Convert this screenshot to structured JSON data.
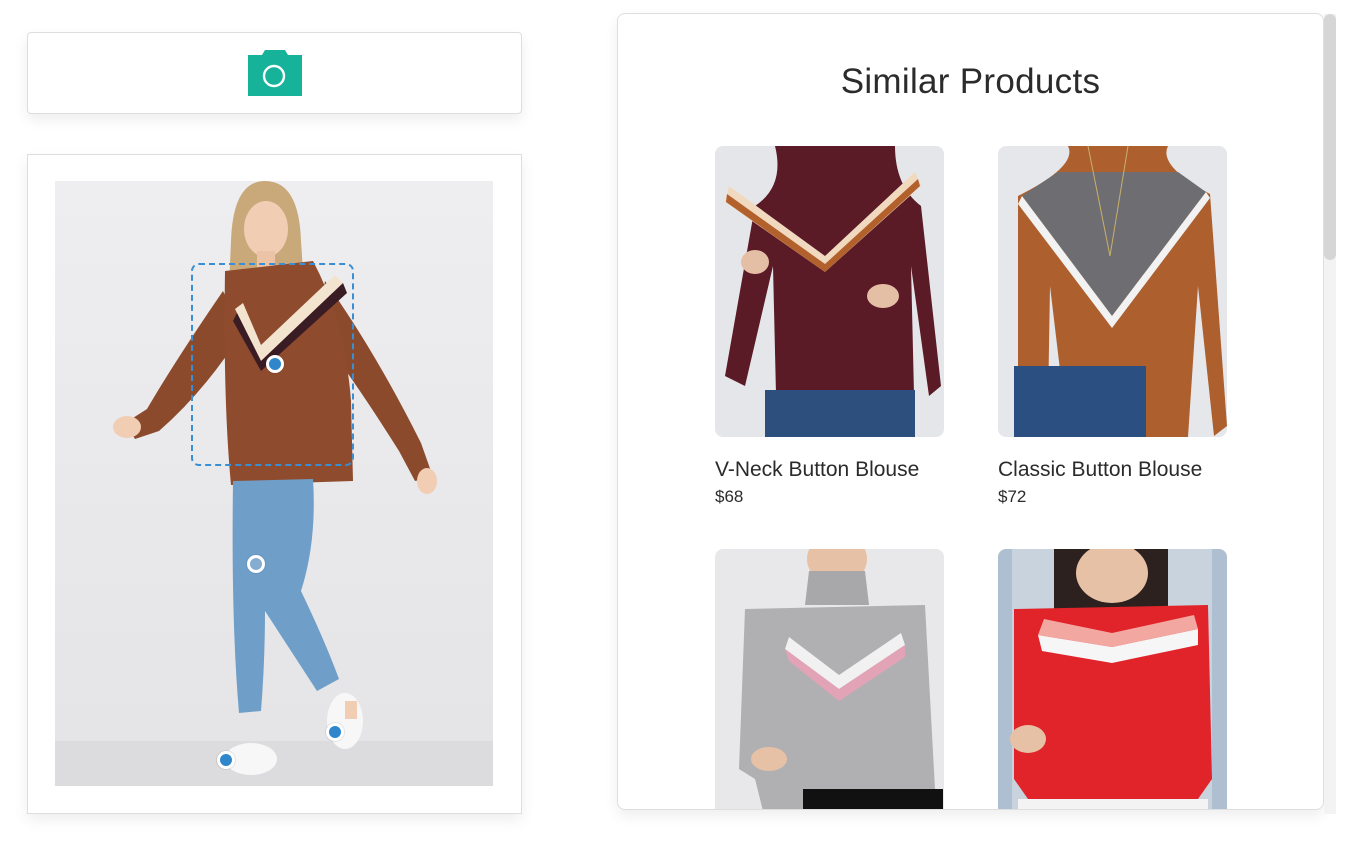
{
  "upload": {
    "icon": "camera-icon",
    "accent_color": "#16b39a"
  },
  "photo": {
    "alt": "Woman wearing brown sweater and jeans",
    "hotspots": [
      {
        "name": "top-hotspot",
        "style": "filled"
      },
      {
        "name": "jeans-hotspot",
        "style": "hollow"
      },
      {
        "name": "right-shoe-hotspot",
        "style": "filled"
      },
      {
        "name": "left-shoe-hotspot",
        "style": "filled"
      }
    ],
    "selection_color": "#3a8ed3"
  },
  "results": {
    "title": "Similar Products",
    "products": [
      {
        "name": "V-Neck Button Blouse",
        "price": "$68"
      },
      {
        "name": "Classic Button Blouse",
        "price": "$72"
      },
      {
        "name": "",
        "price": ""
      },
      {
        "name": "",
        "price": ""
      }
    ]
  }
}
